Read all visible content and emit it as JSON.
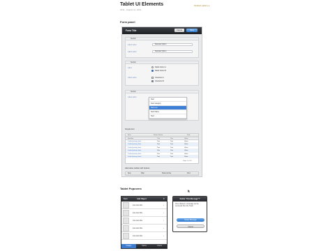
{
  "header": {
    "title": "Tablet UI Elements",
    "date": "2011 · August 11, 2011",
    "link": "Related gallery ▸"
  },
  "form_panel": {
    "section_title": "Form panel",
    "panel_title": "Form Title",
    "cancel_label": "Cancel",
    "save_label": "Save",
    "group1": {
      "heading": "Section",
      "rows": [
        {
          "label": "Label Label",
          "value": "Selected Option"
        },
        {
          "label": "Label Label",
          "value": "Selected Option"
        }
      ]
    },
    "group2": {
      "heading": "Section",
      "label1": "Label",
      "radio_a": "Radio button A",
      "radio_b": "Radio button B",
      "label2": "Label Label",
      "check_a": "Checkbox A",
      "check_b": "Checkbox B"
    },
    "group3": {
      "heading": "Section",
      "label": "Label Label",
      "select_value": "Next",
      "menu_items": [
        "Next category",
        "Next text",
        "Next Name",
        "Next ..."
      ],
      "menu_selected_index": 1
    },
    "table": {
      "title": "Simple form",
      "toolbar": [
        "Next",
        "Status: Active",
        "Find"
      ],
      "headers": [
        "Identifier",
        "Title",
        "Text",
        "Value"
      ],
      "rows": [
        [
          "Linked primary data",
          "Text",
          "Text",
          "Value"
        ],
        [
          "Linked primary data",
          "Text",
          "Text",
          "Value"
        ],
        [
          "Linked primary data",
          "Text",
          "Text",
          "Value"
        ],
        [
          "Linked primary data",
          "Text",
          "Text",
          "Value"
        ],
        [
          "Linked primary data",
          "Text",
          "Text",
          "Value"
        ],
        [
          "Linked primary data",
          "Text",
          "Text",
          "Value"
        ]
      ],
      "pager": "Page 1 of 10"
    },
    "alt_bar": {
      "title": "Alternative toolbar with buttons",
      "items": [
        "New",
        "Filter",
        "Status Active",
        "Find"
      ]
    }
  },
  "popovers": {
    "section_title": "Tablet Popovers",
    "pop1": {
      "back_label": "Back",
      "title": "Add Object",
      "rows": [
        "Line item title",
        "Line item title",
        "Line item title",
        "Line item title",
        "Line item title"
      ],
      "tabs": [
        "Images",
        "Tables",
        "Charts"
      ]
    },
    "pop2": {
      "title": "Delete \"this Message\"?",
      "message": "Once deleted, a message can be recovered from the Trash.",
      "delete_label": "Delete Message",
      "cancel_label": "Cancel"
    }
  },
  "colors": {
    "accent": "#3b7ed6",
    "toolbar_dark": "#24262a",
    "panel_bg": "#e8e9eb"
  }
}
